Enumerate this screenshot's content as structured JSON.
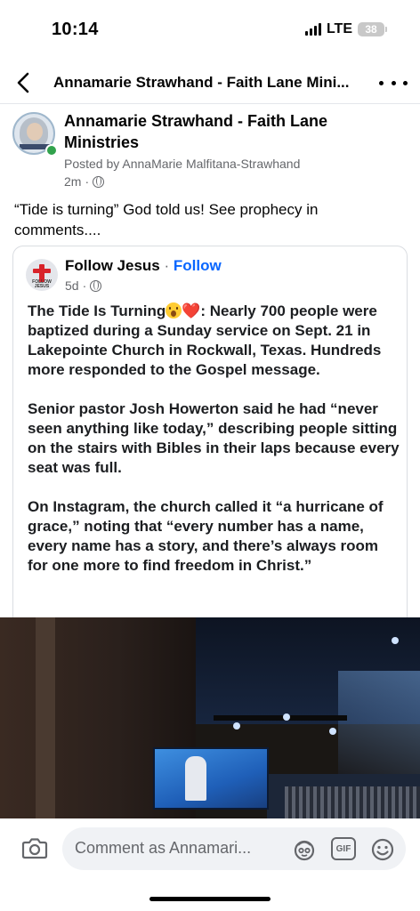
{
  "status_bar": {
    "time": "10:14",
    "network": "LTE",
    "battery": "38"
  },
  "nav": {
    "title": "Annamarie Strawhand - Faith Lane Mini..."
  },
  "post": {
    "author": "Annamarie Strawhand - Faith Lane Ministries",
    "posted_by": "Posted by AnnaMarie Malfitana-Strawhand",
    "time": "2m",
    "text": "“Tide is turning” God told us! See prophecy in comments...."
  },
  "shared": {
    "page_name": "Follow Jesus",
    "separator": "·",
    "follow": "Follow",
    "time": "5d",
    "avatar_text": "FOLLOW JESUS",
    "para1_lead": "The Tide Is Turning",
    "para1_rest": ": Nearly 700 people were baptized during a Sunday service on Sept. 21 in Lakepointe Church in Rockwall, Texas. Hundreds more responded to the Gospel message.",
    "para2": "Senior pastor Josh Howerton said he had “never seen anything like today,” describing people sitting on the stairs with Bibles in their laps because every seat was full.",
    "para3": "On Instagram, the church called it “a hurricane of grace,” noting that “every number has a name, every name has a story, and there’s always room for one more to find freedom in Christ.”"
  },
  "comment_bar": {
    "placeholder": "Comment as Annamari...",
    "gif": "GIF"
  },
  "colors": {
    "link": "#0866ff",
    "secondary": "#65676b",
    "online": "#31a24c"
  }
}
